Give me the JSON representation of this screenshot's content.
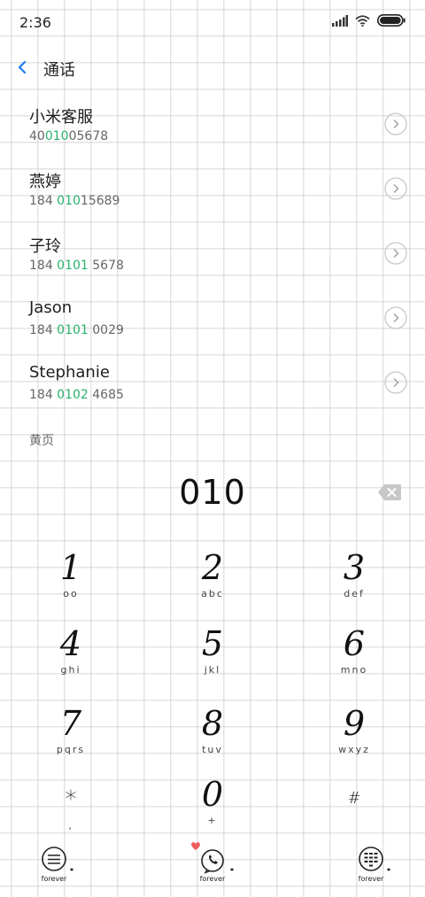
{
  "status": {
    "time": "2:36"
  },
  "header": {
    "title": "通话"
  },
  "contacts": [
    {
      "name": "小米客服",
      "number_parts": [
        "40",
        "010",
        "05678"
      ]
    },
    {
      "name": "燕婷",
      "number_parts": [
        "184 ",
        "010",
        "15689"
      ]
    },
    {
      "name": "子玲",
      "number_parts": [
        "184 ",
        "0101",
        " 5678"
      ]
    },
    {
      "name": "Jason",
      "number_parts": [
        "184 ",
        "0101",
        " 0029"
      ]
    },
    {
      "name": "Stephanie",
      "number_parts": [
        "184 ",
        "0102",
        " 4685"
      ]
    }
  ],
  "section": {
    "yellow_pages": "黄页"
  },
  "dialer": {
    "value": "010"
  },
  "keypad": [
    {
      "digit": "1",
      "letters": "oo"
    },
    {
      "digit": "2",
      "letters": "abc"
    },
    {
      "digit": "3",
      "letters": "def"
    },
    {
      "digit": "4",
      "letters": "ghi"
    },
    {
      "digit": "5",
      "letters": "jkl"
    },
    {
      "digit": "6",
      "letters": "mno"
    },
    {
      "digit": "7",
      "letters": "pqrs"
    },
    {
      "digit": "8",
      "letters": "tuv"
    },
    {
      "digit": "9",
      "letters": "wxyz"
    },
    {
      "digit": "*",
      "letters": ","
    },
    {
      "digit": "0",
      "letters": "+"
    },
    {
      "digit": "#",
      "letters": ""
    }
  ],
  "bottom_bar": {
    "menu_caption": "forever",
    "call_caption": "forever",
    "keypad_caption": "forever"
  },
  "colors": {
    "accent_blue": "#1a7cf0",
    "match_green": "#27b36a",
    "heart_red": "#ef5b5b"
  }
}
